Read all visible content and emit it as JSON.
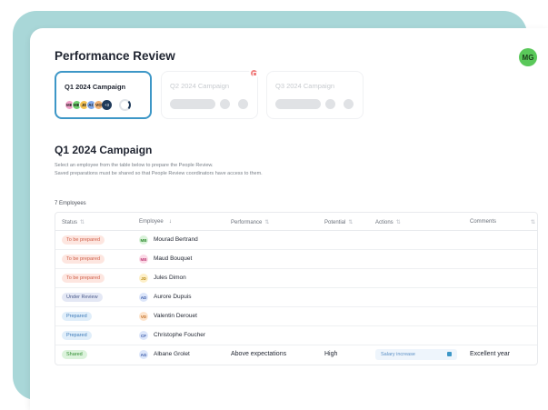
{
  "header": {
    "title": "Performance Review",
    "user_initials": "MG"
  },
  "campaigns": [
    {
      "name": "Q1 2024 Campaign",
      "active": true,
      "extra_count": "+3"
    },
    {
      "name": "Q2 2024 Campaign",
      "active": false
    },
    {
      "name": "Q3 2024 Campaign",
      "active": false
    }
  ],
  "campaign_avatars": [
    {
      "initials": "MB",
      "color": "#f0a0c8"
    },
    {
      "initials": "MB",
      "color": "#6fcf6f"
    },
    {
      "initials": "JD",
      "color": "#f4c150"
    },
    {
      "initials": "AC",
      "color": "#7fa6e8"
    },
    {
      "initials": "VO",
      "color": "#f0b070"
    }
  ],
  "section": {
    "title": "Q1 2024 Campaign",
    "desc_line1": "Select an employee from the table below to prepare the People Review.",
    "desc_line2": "Saved preparations must be shared so that People Review coordinators have access to them."
  },
  "table": {
    "count": "7 Employees",
    "headers": {
      "status": "Status",
      "employee": "Employee",
      "performance": "Performance",
      "potential": "Potential",
      "actions": "Actions",
      "comments": "Comments"
    },
    "rows": [
      {
        "status": "To be prepared",
        "status_bg": "#fde6e0",
        "status_fg": "#d0604a",
        "initials": "MB",
        "av_bg": "#d9f2d9",
        "av_fg": "#2e8b2e",
        "name": "Mourad Bertrand",
        "performance": "",
        "potential": "",
        "action": "",
        "comment": ""
      },
      {
        "status": "To be prepared",
        "status_bg": "#fde6e0",
        "status_fg": "#d0604a",
        "initials": "MB",
        "av_bg": "#fbd9e6",
        "av_fg": "#c0407a",
        "name": "Maud Bouquet",
        "performance": "",
        "potential": "",
        "action": "",
        "comment": ""
      },
      {
        "status": "To be prepared",
        "status_bg": "#fde6e0",
        "status_fg": "#d0604a",
        "initials": "JD",
        "av_bg": "#fdefc8",
        "av_fg": "#b8860b",
        "name": "Jules Dimon",
        "performance": "",
        "potential": "",
        "action": "",
        "comment": ""
      },
      {
        "status": "Under Review",
        "status_bg": "#e4e8f5",
        "status_fg": "#4a5a8a",
        "initials": "AD",
        "av_bg": "#dce6fa",
        "av_fg": "#3a5aa8",
        "name": "Aurore Dupuis",
        "performance": "",
        "potential": "",
        "action": "",
        "comment": ""
      },
      {
        "status": "Prepared",
        "status_bg": "#e0eefa",
        "status_fg": "#3d7ab8",
        "initials": "VD",
        "av_bg": "#fde4cc",
        "av_fg": "#c06a20",
        "name": "Valentin Derouet",
        "performance": "",
        "potential": "",
        "action": "",
        "comment": ""
      },
      {
        "status": "Prepared",
        "status_bg": "#e0eefa",
        "status_fg": "#3d7ab8",
        "initials": "CF",
        "av_bg": "#dce6fa",
        "av_fg": "#3a5aa8",
        "name": "Christophe Foucher",
        "performance": "",
        "potential": "",
        "action": "",
        "comment": ""
      },
      {
        "status": "Shared",
        "status_bg": "#dcf3dc",
        "status_fg": "#2e8b2e",
        "initials": "AG",
        "av_bg": "#dce6fa",
        "av_fg": "#3a5aa8",
        "name": "Albane Grolet",
        "performance": "Above expectations",
        "potential": "High",
        "action": "Salary increase",
        "comment": "Excellent year"
      }
    ]
  }
}
